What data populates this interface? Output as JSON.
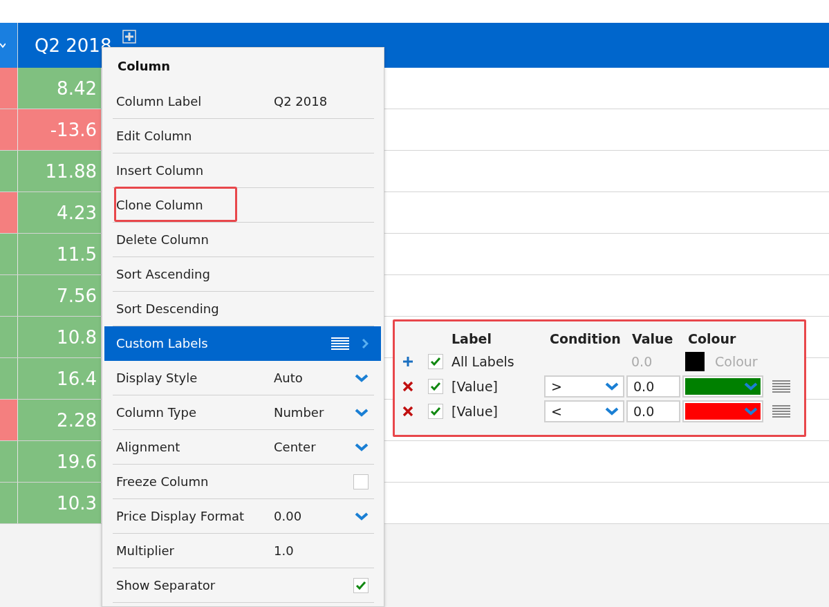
{
  "table": {
    "header": {
      "column_label": "Q2 2018"
    },
    "rows": [
      {
        "cells": [
          {
            "color": "#f47f7f"
          },
          {
            "text": "8.42",
            "color": "#80c080"
          }
        ]
      },
      {
        "cells": [
          {
            "color": "#f47f7f"
          },
          {
            "text": "-13.6",
            "color": "#f47f7f"
          }
        ]
      },
      {
        "cells": [
          {
            "color": "#80c080"
          },
          {
            "text": "11.88",
            "color": "#80c080"
          }
        ]
      },
      {
        "cells": [
          {
            "color": "#f47f7f"
          },
          {
            "text": "4.23",
            "color": "#80c080"
          }
        ]
      },
      {
        "cells": [
          {
            "color": "#80c080"
          },
          {
            "text": "11.5",
            "color": "#80c080"
          }
        ]
      },
      {
        "cells": [
          {
            "color": "#80c080"
          },
          {
            "text": "7.56",
            "color": "#80c080"
          }
        ]
      },
      {
        "cells": [
          {
            "color": "#80c080"
          },
          {
            "text": "10.8",
            "color": "#80c080"
          }
        ]
      },
      {
        "cells": [
          {
            "color": "#80c080"
          },
          {
            "text": "16.4",
            "color": "#80c080"
          }
        ]
      },
      {
        "cells": [
          {
            "color": "#f47f7f"
          },
          {
            "text": "2.28",
            "color": "#80c080"
          }
        ]
      },
      {
        "cells": [
          {
            "color": "#80c080"
          },
          {
            "text": "19.6",
            "color": "#80c080"
          }
        ]
      },
      {
        "cells": [
          {
            "color": "#80c080"
          },
          {
            "text": "10.3",
            "color": "#80c080"
          }
        ]
      }
    ]
  },
  "menu": {
    "title": "Column",
    "items": [
      {
        "kind": "value",
        "label": "Column Label",
        "value": "Q2 2018",
        "selected": false,
        "highlighted": false
      },
      {
        "kind": "action",
        "label": "Edit Column",
        "selected": false,
        "highlighted": false
      },
      {
        "kind": "action",
        "label": "Insert Column",
        "selected": false,
        "highlighted": false
      },
      {
        "kind": "action",
        "label": "Clone Column",
        "selected": false,
        "highlighted": true
      },
      {
        "kind": "action",
        "label": "Delete Column",
        "selected": false,
        "highlighted": false
      },
      {
        "kind": "action",
        "label": "Sort Ascending",
        "selected": false,
        "highlighted": false
      },
      {
        "kind": "action",
        "label": "Sort Descending",
        "selected": false,
        "highlighted": false
      },
      {
        "kind": "submenu",
        "label": "Custom Labels",
        "selected": true,
        "highlighted": false
      },
      {
        "kind": "dropdown",
        "label": "Display Style",
        "value": "Auto",
        "selected": false,
        "highlighted": false
      },
      {
        "kind": "dropdown",
        "label": "Column Type",
        "value": "Number",
        "selected": false,
        "highlighted": false
      },
      {
        "kind": "dropdown",
        "label": "Alignment",
        "value": "Center",
        "selected": false,
        "highlighted": false
      },
      {
        "kind": "checkbox",
        "label": "Freeze Column",
        "checked": false,
        "selected": false,
        "highlighted": false
      },
      {
        "kind": "dropdown",
        "label": "Price Display Format",
        "value": "0.00",
        "selected": false,
        "highlighted": false
      },
      {
        "kind": "value",
        "label": "Multiplier",
        "value": "1.0",
        "selected": false,
        "highlighted": false
      },
      {
        "kind": "checkbox",
        "label": "Show Separator",
        "checked": true,
        "selected": false,
        "highlighted": false
      }
    ]
  },
  "custom_labels": {
    "highlighted": true,
    "columns": [
      "Label",
      "Condition",
      "Value",
      "Colour"
    ],
    "rows": [
      {
        "kind": "all",
        "checked": true,
        "label": "All Labels",
        "value": "0.0",
        "color": "#000000",
        "colour_placeholder": "Colour"
      },
      {
        "kind": "rule",
        "checked": true,
        "label": "[Value]",
        "condition": ">",
        "value": "0.0",
        "color": "#008000"
      },
      {
        "kind": "rule",
        "checked": true,
        "label": "[Value]",
        "condition": "<",
        "value": "0.0",
        "color": "#ff0000"
      }
    ]
  }
}
